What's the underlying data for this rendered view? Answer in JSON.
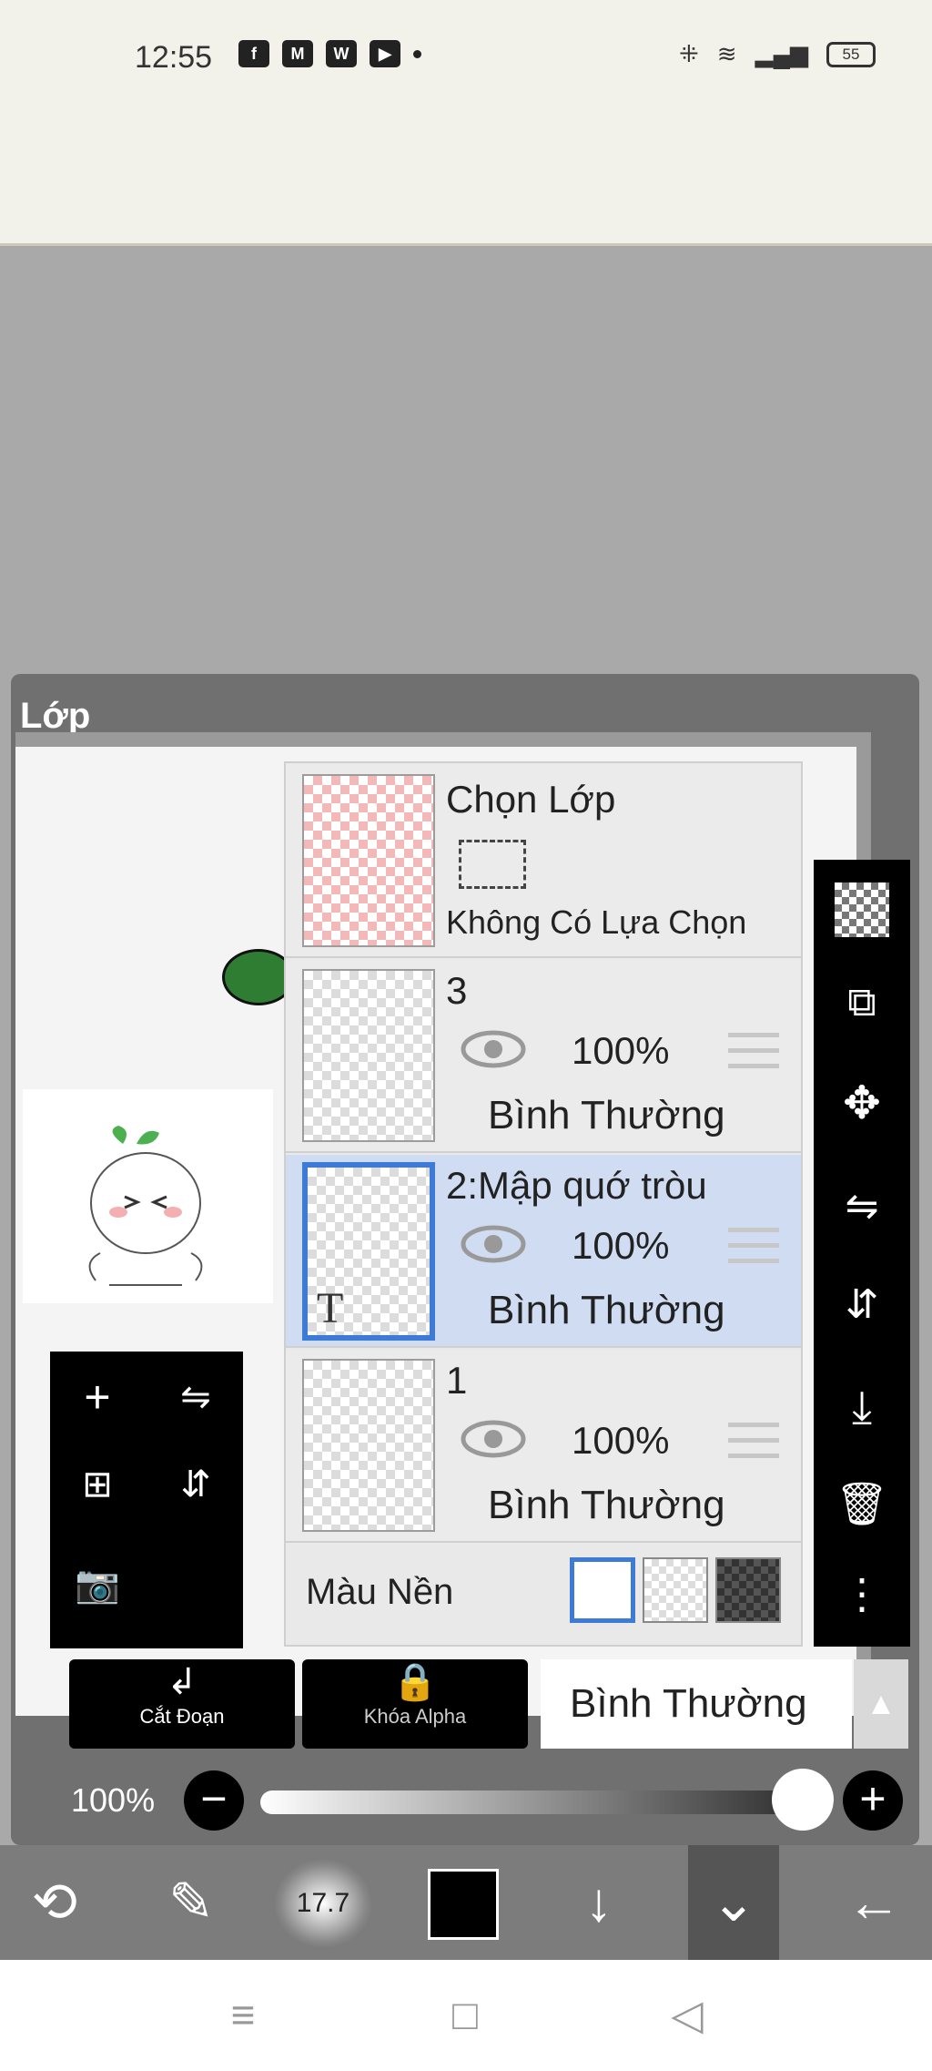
{
  "status_bar": {
    "time": "12:55",
    "app_icons": [
      "f",
      "M",
      "W",
      "▶"
    ],
    "battery": "55"
  },
  "panel": {
    "title": "Lớp"
  },
  "layers": {
    "selection": {
      "title": "Chọn Lớp",
      "subtitle": "Không Có Lựa Chọn"
    },
    "items": [
      {
        "name": "3",
        "opacity": "100%",
        "blend": "Bình Thường",
        "selected": false
      },
      {
        "name": "2:Mập quớ tròu",
        "opacity": "100%",
        "blend": "Bình Thường",
        "selected": true,
        "thumb_label": "T"
      },
      {
        "name": "1",
        "opacity": "100%",
        "blend": "Bình Thường",
        "selected": false
      }
    ],
    "background_label": "Màu Nền"
  },
  "actions": {
    "clip_label": "Cắt Đoạn",
    "alpha_lock_label": "Khóa Alpha",
    "blend_mode": "Bình Thường"
  },
  "opacity": {
    "value_label": "100%",
    "value": 1.0
  },
  "toolbar": {
    "brush_size": "17.7"
  },
  "colors": {
    "selected_layer": "#cfdcf2",
    "selected_border": "#3d7bd6",
    "primary_color": "#000000"
  }
}
